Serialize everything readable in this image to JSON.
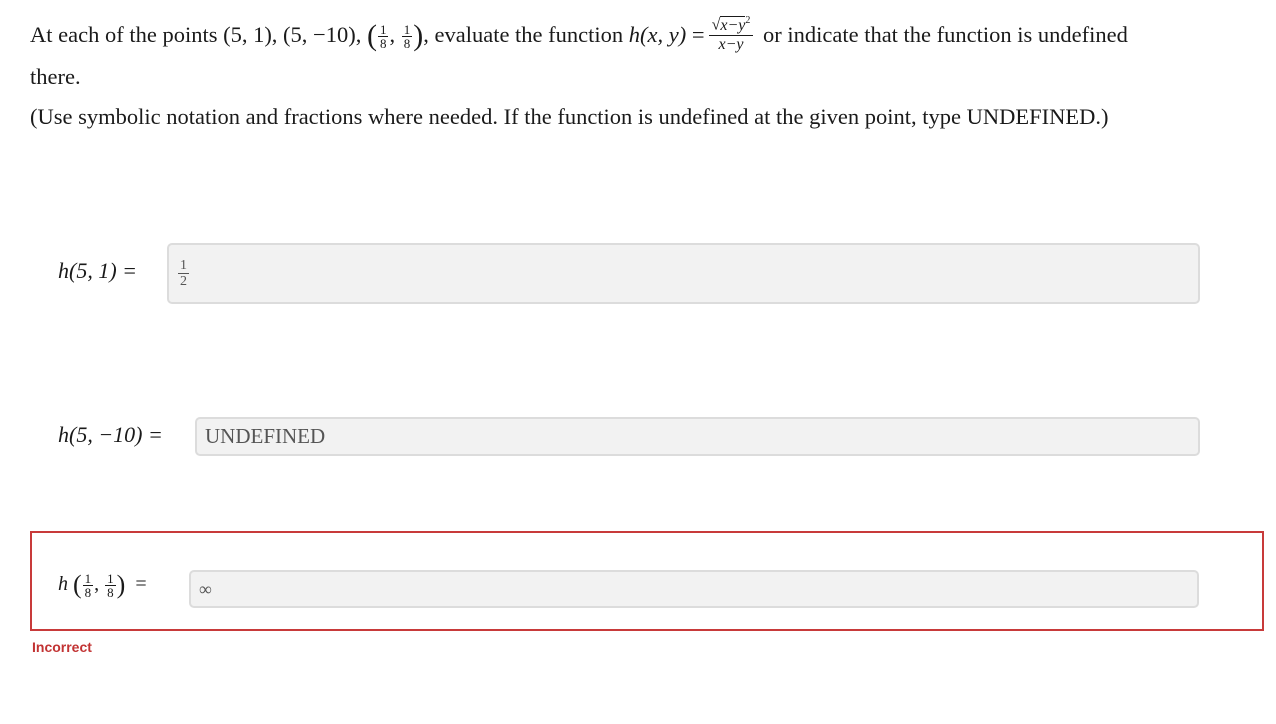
{
  "prompt": {
    "part1": "At each of the points (5, 1), (5, −10), ",
    "point3_x": {
      "num": "1",
      "den": "8"
    },
    "point3_y": {
      "num": "1",
      "den": "8"
    },
    "part2": ", evaluate the function ",
    "func_name": "h(x, y)",
    "equals": "=",
    "numerator_sqrt": "x−y",
    "numerator_exp": "2",
    "denominator": "x−y",
    "part3": " or indicate that the function is undefined",
    "part4": "there."
  },
  "note": "(Use symbolic notation and fractions where needed. If the function is undefined at the given point, type UNDEFINED.)",
  "answers": [
    {
      "label": "h(5, 1) =",
      "value_num": "1",
      "value_den": "2"
    },
    {
      "label": "h(5, −10) =",
      "value": "UNDEFINED"
    },
    {
      "label_fn": "h",
      "arg_x": {
        "num": "1",
        "den": "8"
      },
      "arg_y": {
        "num": "1",
        "den": "8"
      },
      "equals": "=",
      "value": "∞",
      "status": "Incorrect"
    }
  ]
}
